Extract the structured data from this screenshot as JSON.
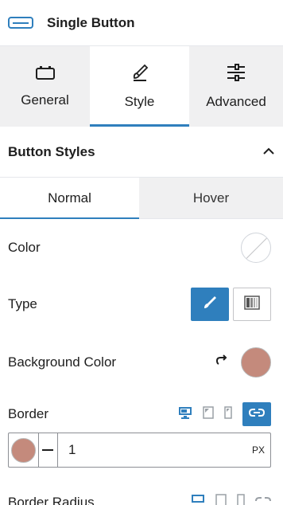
{
  "header": {
    "title": "Single Button",
    "icon": "button-block-icon"
  },
  "tabs": [
    {
      "label": "General",
      "icon": "general-icon",
      "active": false
    },
    {
      "label": "Style",
      "icon": "brush-icon",
      "active": true
    },
    {
      "label": "Advanced",
      "icon": "sliders-icon",
      "active": false
    }
  ],
  "section": {
    "title": "Button Styles",
    "expanded": true
  },
  "state_tabs": [
    {
      "label": "Normal",
      "active": true
    },
    {
      "label": "Hover",
      "active": false
    }
  ],
  "fields": {
    "color": {
      "label": "Color",
      "value": "none"
    },
    "type": {
      "label": "Type",
      "options": [
        "classic",
        "gradient"
      ],
      "selected": "classic"
    },
    "background_color": {
      "label": "Background Color",
      "value": "#c48a7c"
    },
    "border": {
      "label": "Border",
      "color": "#c48a7c",
      "width": "1",
      "unit": "PX",
      "device": "desktop",
      "linked": true
    },
    "border_radius": {
      "label": "Border Radius"
    }
  },
  "colors": {
    "accent": "#2f7fbd",
    "swatch": "#c48a7c"
  }
}
